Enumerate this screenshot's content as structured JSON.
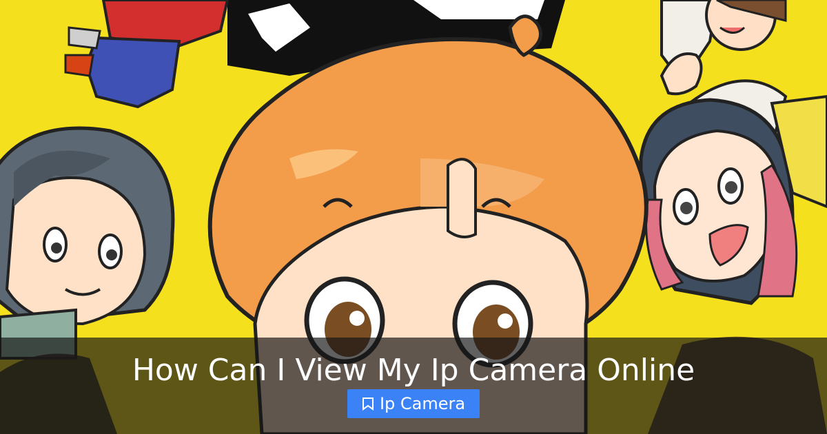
{
  "headline": "How Can I View My Ip Camera Online",
  "tag": {
    "icon": "tag-icon",
    "label": "Ip Camera"
  },
  "colors": {
    "background_yellow": "#f5e01d",
    "accent_blue": "#3b82f6",
    "overlay": "#141414"
  }
}
